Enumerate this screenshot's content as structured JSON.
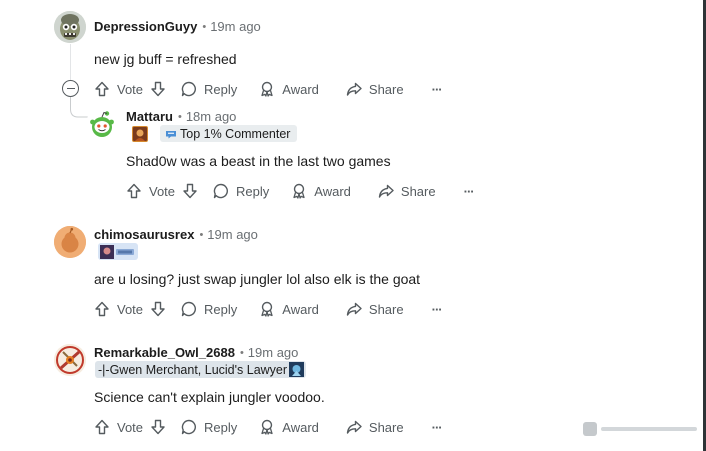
{
  "actions": {
    "vote": "Vote",
    "reply": "Reply",
    "award": "Award",
    "share": "Share",
    "more": "···"
  },
  "comments": [
    {
      "username": "DepressionGuyy",
      "time": "19m ago",
      "body": "new jg buff = refreshed",
      "avatar": "zombie-avatar"
    },
    {
      "username": "Mattaru",
      "time": "18m ago",
      "flair": "Top 1% Commenter",
      "body": "Shad0w was a beast in the last two games",
      "avatar": "snoo-avatar"
    },
    {
      "username": "chimosaurusrex",
      "time": "19m ago",
      "flair": "",
      "body": "are u losing? just swap jungler lol also elk is the goat",
      "avatar": "default-avatar"
    },
    {
      "username": "Remarkable_Owl_2688",
      "time": "19m ago",
      "flair": "-|-Gwen Merchant, Lucid's Lawyer",
      "body": "Science can't explain jungler voodoo.",
      "avatar": "emblem-avatar"
    }
  ],
  "colors": {
    "text": "#1c1c1c",
    "muted": "#6a6f73",
    "icon": "#555b5f",
    "flair_bg": "#e9edef"
  }
}
